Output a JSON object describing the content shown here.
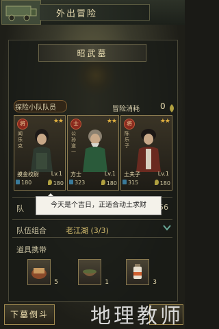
{
  "header": {
    "title": "外出冒险",
    "vehicle_icon": "wagon-icon"
  },
  "location": {
    "name": "昭武墓"
  },
  "team": {
    "label": "探险小队队员",
    "cost_label": "冒险消耗",
    "cost_value": "0"
  },
  "cards": [
    {
      "vertical_name": "闻乐克",
      "badge": "将",
      "stars": "★★",
      "role": "摸金校尉",
      "level": "Lv.1",
      "hp": "180",
      "food": "180"
    },
    {
      "vertical_name": "公孙道一",
      "badge": "士",
      "stars": "★★",
      "role": "方士",
      "level": "Lv.1",
      "hp": "323",
      "food": "180"
    },
    {
      "vertical_name": "陈乐子",
      "badge": "将",
      "stars": "★★",
      "role": "土夫子",
      "level": "Lv.1",
      "hp": "315",
      "food": "180"
    }
  ],
  "rows": {
    "row1_label": "队",
    "row1_value": "56",
    "combo_label": "队伍组合",
    "combo_value": "老江湖 (3/3)"
  },
  "tooltip": {
    "text": "今天是个吉日，正适合动土求财"
  },
  "items": {
    "label": "道具携带",
    "slots": [
      {
        "icon": "book-icon",
        "count": "5"
      },
      {
        "icon": "herb-bowl-icon",
        "count": "1"
      },
      {
        "icon": "medicine-bottle-icon",
        "count": "3"
      }
    ]
  },
  "footer": {
    "button_label": "下墓倒斗",
    "watermark": "地理教师"
  },
  "colors": {
    "accent": "#a08a50",
    "badge_red": "#8a2a1e",
    "panel_bg": "#1e1e18"
  }
}
